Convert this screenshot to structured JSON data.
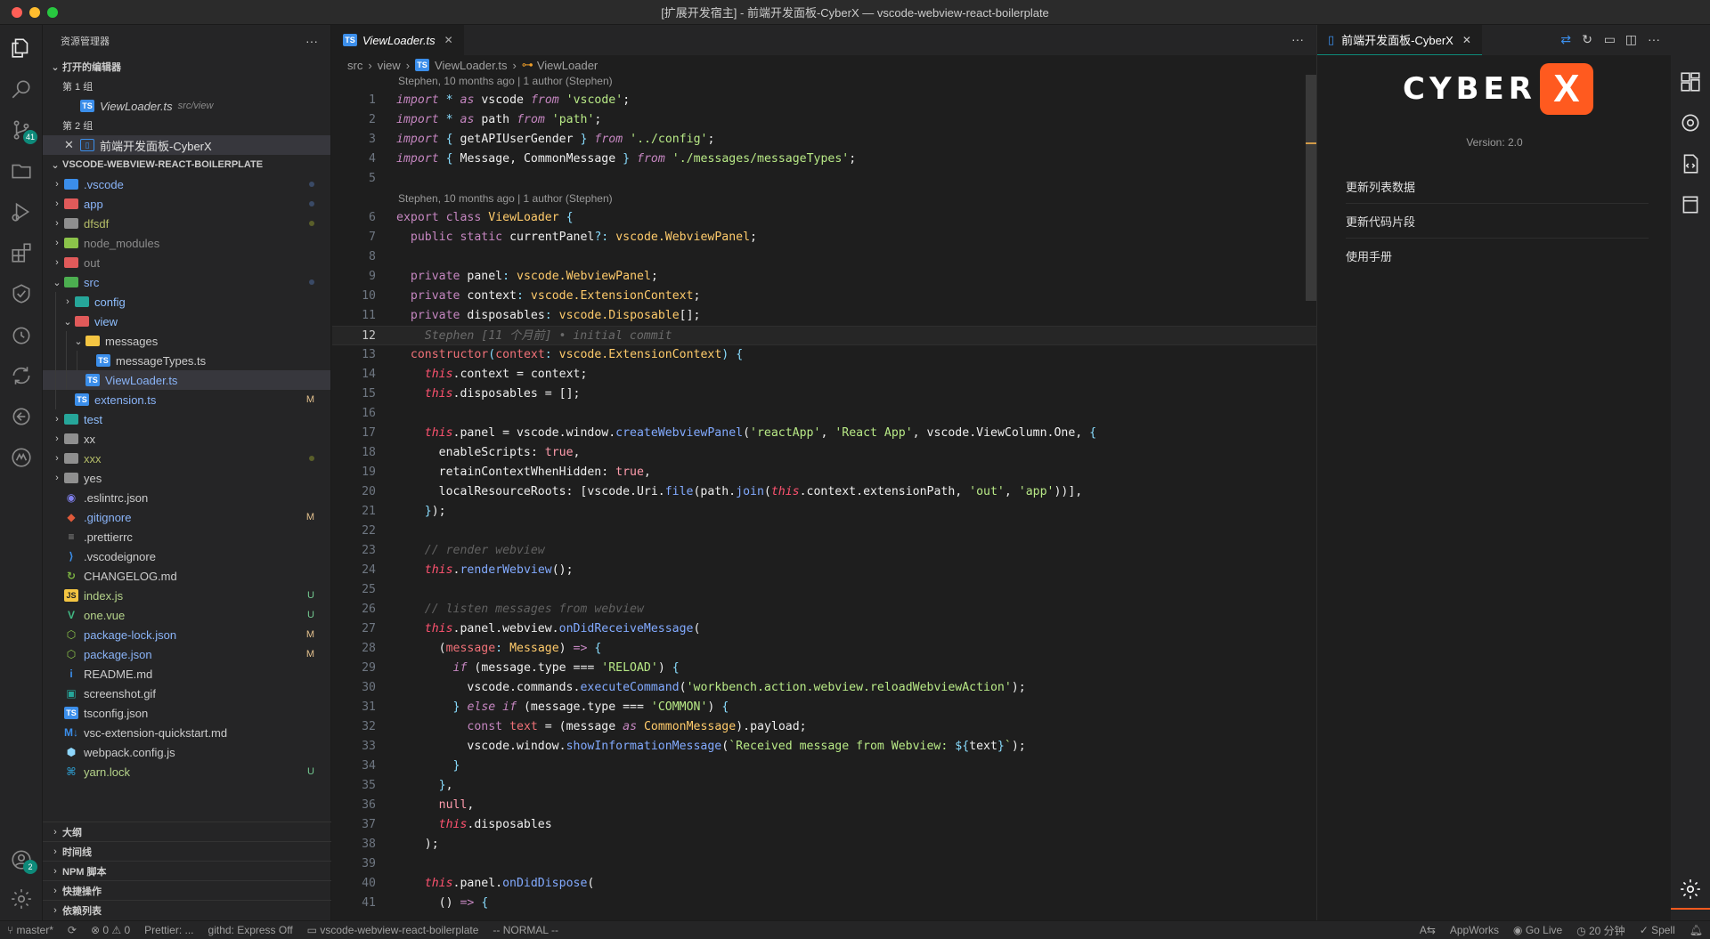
{
  "window": {
    "title": "[扩展开发宿主] - 前端开发面板-CyberX — vscode-webview-react-boilerplate"
  },
  "activity_bar": {
    "items": [
      "files-icon",
      "search-icon",
      "source-control-icon",
      "remote-explorer-icon",
      "run-debug-icon",
      "extensions-icon",
      "testing-icon",
      "timeline-icon",
      "live-share-icon",
      "gitlens-icon",
      "appworks-icon"
    ],
    "source_control_badge": "41",
    "accounts_badge": "2"
  },
  "explorer": {
    "title": "资源管理器",
    "open_editors_title": "打开的编辑器",
    "group1": "第 1 组",
    "group1_file": "ViewLoader.ts",
    "group1_path": "src/view",
    "group2": "第 2 组",
    "group2_file": "前端开发面板-CyberX",
    "project_title": "VSCODE-WEBVIEW-REACT-BOILERPLATE",
    "tree": [
      {
        "name": ".vscode",
        "depth": 0,
        "type": "folder",
        "color": "#3b8eea",
        "expanded": false,
        "status": "dot"
      },
      {
        "name": "app",
        "depth": 0,
        "type": "folder",
        "color": "#e05a5a",
        "expanded": false,
        "status": "dot"
      },
      {
        "name": "dfsdf",
        "depth": 0,
        "type": "folder",
        "color": "#8f8f8f",
        "expanded": false,
        "status": "dot-olive"
      },
      {
        "name": "node_modules",
        "depth": 0,
        "type": "folder",
        "color": "#8bc34a",
        "expanded": false,
        "status": ""
      },
      {
        "name": "out",
        "depth": 0,
        "type": "folder",
        "color": "#e05a5a",
        "expanded": false,
        "status": ""
      },
      {
        "name": "src",
        "depth": 0,
        "type": "folder",
        "color": "#4caf50",
        "expanded": true,
        "status": "dot"
      },
      {
        "name": "config",
        "depth": 1,
        "type": "folder",
        "color": "#26a69a",
        "expanded": false,
        "status": ""
      },
      {
        "name": "view",
        "depth": 1,
        "type": "folder",
        "color": "#e05a5a",
        "expanded": true,
        "status": ""
      },
      {
        "name": "messages",
        "depth": 2,
        "type": "folder",
        "color": "#f4c542",
        "expanded": true,
        "status": ""
      },
      {
        "name": "messageTypes.ts",
        "depth": 3,
        "type": "ts",
        "color": "#3b8eea",
        "status": ""
      },
      {
        "name": "ViewLoader.ts",
        "depth": 2,
        "type": "ts",
        "color": "#3b8eea",
        "status": "",
        "selected": true
      },
      {
        "name": "extension.ts",
        "depth": 1,
        "type": "ts",
        "color": "#3b8eea",
        "status": "M"
      },
      {
        "name": "test",
        "depth": 0,
        "type": "folder",
        "color": "#26a69a",
        "expanded": false,
        "status": ""
      },
      {
        "name": "xx",
        "depth": 0,
        "type": "folder",
        "color": "#8f8f8f",
        "expanded": false,
        "status": ""
      },
      {
        "name": "xxx",
        "depth": 0,
        "type": "folder",
        "color": "#8f8f8f",
        "expanded": false,
        "status": "dot-olive"
      },
      {
        "name": "yes",
        "depth": 0,
        "type": "folder",
        "color": "#8f8f8f",
        "expanded": false,
        "status": ""
      },
      {
        "name": ".eslintrc.json",
        "depth": 0,
        "type": "eslint",
        "color": "#8080f0",
        "status": ""
      },
      {
        "name": ".gitignore",
        "depth": 0,
        "type": "git",
        "color": "#e05a3a",
        "status": "M"
      },
      {
        "name": ".prettierrc",
        "depth": 0,
        "type": "prettier",
        "color": "#8f8f8f",
        "status": ""
      },
      {
        "name": ".vscodeignore",
        "depth": 0,
        "type": "vscode",
        "color": "#3b8eea",
        "status": ""
      },
      {
        "name": "CHANGELOG.md",
        "depth": 0,
        "type": "changelog",
        "color": "#7cb342",
        "status": ""
      },
      {
        "name": "index.js",
        "depth": 0,
        "type": "js",
        "color": "#f4c542",
        "status": "U"
      },
      {
        "name": "one.vue",
        "depth": 0,
        "type": "vue",
        "color": "#41b883",
        "status": "U"
      },
      {
        "name": "package-lock.json",
        "depth": 0,
        "type": "npm",
        "color": "#8bc34a",
        "status": "M"
      },
      {
        "name": "package.json",
        "depth": 0,
        "type": "npm",
        "color": "#8bc34a",
        "status": "M"
      },
      {
        "name": "README.md",
        "depth": 0,
        "type": "info",
        "color": "#3b8eea",
        "status": ""
      },
      {
        "name": "screenshot.gif",
        "depth": 0,
        "type": "image",
        "color": "#26a69a",
        "status": ""
      },
      {
        "name": "tsconfig.json",
        "depth": 0,
        "type": "tsconfig",
        "color": "#3b8eea",
        "status": ""
      },
      {
        "name": "vsc-extension-quickstart.md",
        "depth": 0,
        "type": "md",
        "color": "#3b8eea",
        "status": ""
      },
      {
        "name": "webpack.config.js",
        "depth": 0,
        "type": "webpack",
        "color": "#8ed6fb",
        "status": ""
      },
      {
        "name": "yarn.lock",
        "depth": 0,
        "type": "yarn",
        "color": "#2c8ebb",
        "status": "U"
      }
    ],
    "bottom_sections": [
      "大纲",
      "时间线",
      "NPM 脚本",
      "快捷操作",
      "依赖列表"
    ]
  },
  "editor": {
    "tab_label": "ViewLoader.ts",
    "breadcrumb": [
      "src",
      "view",
      "ViewLoader.ts",
      "ViewLoader"
    ],
    "blame1": "Stephen, 10 months ago | 1 author (Stephen)",
    "blame2": "Stephen, 10 months ago | 1 author (Stephen)",
    "inline_blame": "Stephen [11 个月前] • initial commit",
    "current_line": "12"
  },
  "panel": {
    "tab_label": "前端开发面板-CyberX",
    "logo_text": "CYBER",
    "logo_x": "X",
    "version": "Version: 2.0",
    "menu": [
      "更新列表数据",
      "更新代码片段",
      "使用手册"
    ]
  },
  "status_bar": {
    "branch": "master*",
    "errors": "0",
    "warnings": "0",
    "prettier": "Prettier: ...",
    "githd": "githd: Express Off",
    "folder": "vscode-webview-react-boilerplate",
    "mode": "-- NORMAL --",
    "appworks": "AppWorks",
    "golive": "Go Live",
    "time": "20 分钟",
    "spell": "Spell"
  },
  "colors": {
    "accent": "#0e8a7a",
    "logo_orange": "#ff5a1f",
    "selection": "#37373d"
  }
}
